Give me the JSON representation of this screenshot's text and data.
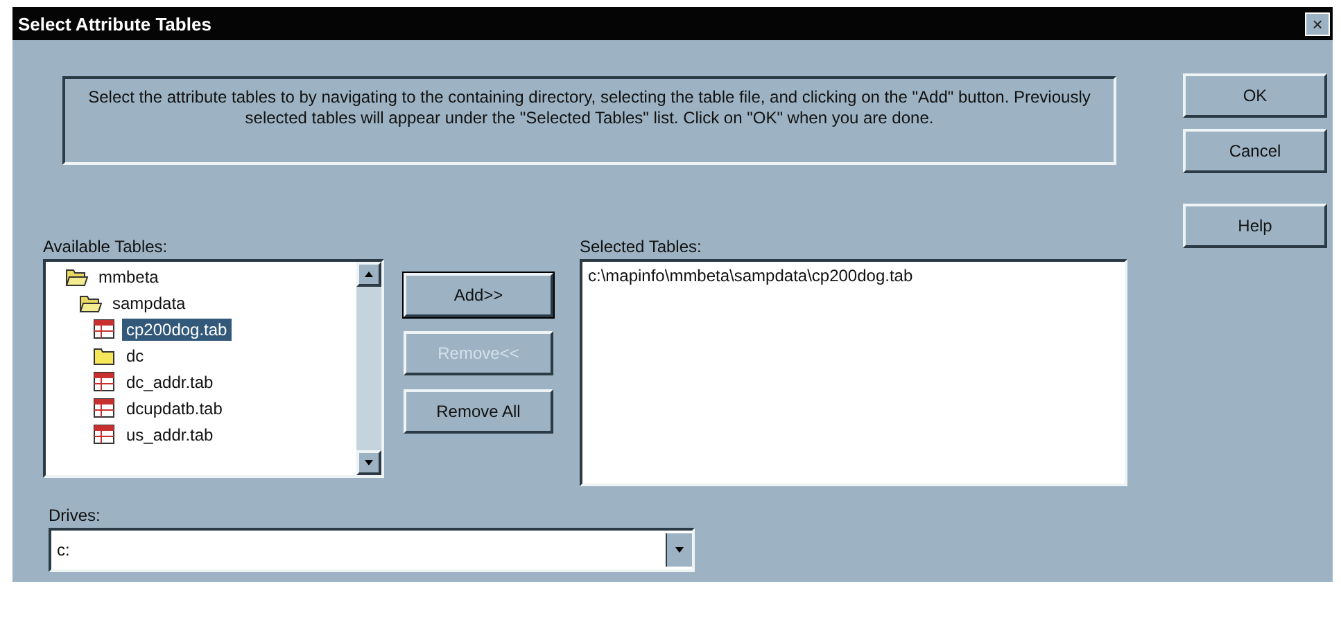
{
  "window": {
    "title": "Select Attribute Tables",
    "close": "×"
  },
  "instructions": "Select the attribute tables to by navigating to the containing directory, selecting the table file, and clicking on the \"Add\" button.  Previously selected tables will appear under the \"Selected Tables\" list.  Click on \"OK\" when you are done.",
  "dialog_buttons": [
    {
      "label": "OK",
      "disabled": false
    },
    {
      "label": "Cancel",
      "disabled": false
    },
    {
      "label": "Help",
      "disabled": false
    }
  ],
  "available_tables": {
    "label": "Available Tables:",
    "items": [
      {
        "name": "mmbeta",
        "kind": "folder",
        "expanded": true,
        "selected": false,
        "children": [
          {
            "name": "sampdata",
            "kind": "folder",
            "expanded": true,
            "selected": false,
            "children": [
              {
                "name": "cp200dog.tab",
                "kind": "table",
                "selected": true
              },
              {
                "name": "dc",
                "kind": "folder",
                "expanded": false,
                "selected": false
              },
              {
                "name": "dc_addr.tab",
                "kind": "table",
                "selected": false
              },
              {
                "name": "dcupdatb.tab",
                "kind": "table",
                "selected": false
              },
              {
                "name": "us_addr.tab",
                "kind": "table",
                "selected": false
              }
            ]
          }
        ]
      }
    ]
  },
  "transfer_buttons": [
    {
      "label": "Add>>",
      "disabled": false,
      "default": true
    },
    {
      "label": "Remove<<",
      "disabled": true,
      "default": false
    },
    {
      "label": "Remove All",
      "disabled": false,
      "default": false
    }
  ],
  "selected_tables": {
    "label": "Selected Tables:",
    "items": [
      "c:\\mapinfo\\mmbeta\\sampdata\\cp200dog.tab"
    ]
  },
  "drives": {
    "label": "Drives:",
    "value": "c:"
  }
}
